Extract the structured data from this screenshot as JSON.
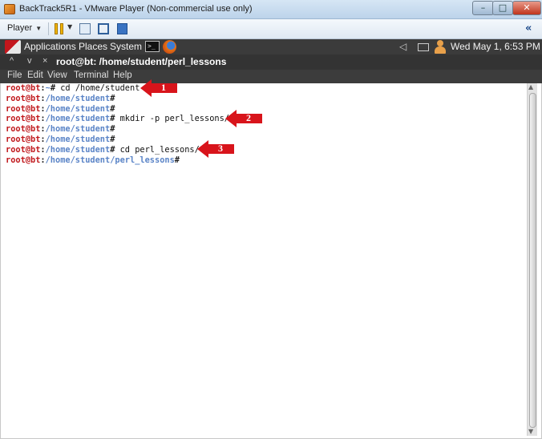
{
  "window": {
    "title": "BackTrack5R1 - VMware Player (Non-commercial use only)",
    "controls": [
      "–",
      "□",
      "✕"
    ]
  },
  "player_toolbar": {
    "player_label": "Player",
    "collapse_glyph": "«"
  },
  "gnome_panel": {
    "menus": [
      "Applications",
      "Places",
      "System"
    ],
    "terminal_glyph": ">_",
    "clock": "Wed May  1,  6:53 PM"
  },
  "terminal": {
    "title": "root@bt: /home/student/perl_lessons",
    "title_controls": [
      "^",
      "v",
      "×"
    ],
    "menu": [
      "File",
      "Edit",
      "View",
      "Terminal",
      "Help"
    ],
    "lines": [
      {
        "user": "root@bt",
        "sep": ":",
        "path": "~",
        "end": "#",
        "cmd": " cd /home/student"
      },
      {
        "user": "root@bt",
        "sep": ":",
        "path": "/home/student",
        "end": "#",
        "cmd": ""
      },
      {
        "user": "root@bt",
        "sep": ":",
        "path": "/home/student",
        "end": "#",
        "cmd": ""
      },
      {
        "user": "root@bt",
        "sep": ":",
        "path": "/home/student",
        "end": "#",
        "cmd": " mkdir -p perl_lessons/"
      },
      {
        "user": "root@bt",
        "sep": ":",
        "path": "/home/student",
        "end": "#",
        "cmd": ""
      },
      {
        "user": "root@bt",
        "sep": ":",
        "path": "/home/student",
        "end": "#",
        "cmd": ""
      },
      {
        "user": "root@bt",
        "sep": ":",
        "path": "/home/student",
        "end": "#",
        "cmd": " cd perl_lessons/"
      },
      {
        "user": "root@bt",
        "sep": ":",
        "path": "/home/student/perl_lessons",
        "end": "#",
        "cmd": ""
      }
    ]
  },
  "callouts": [
    "1",
    "2",
    "3"
  ],
  "colors": {
    "prompt_user": "#c0171b",
    "prompt_path": "#5a84c7",
    "arrow": "#d8141b"
  }
}
